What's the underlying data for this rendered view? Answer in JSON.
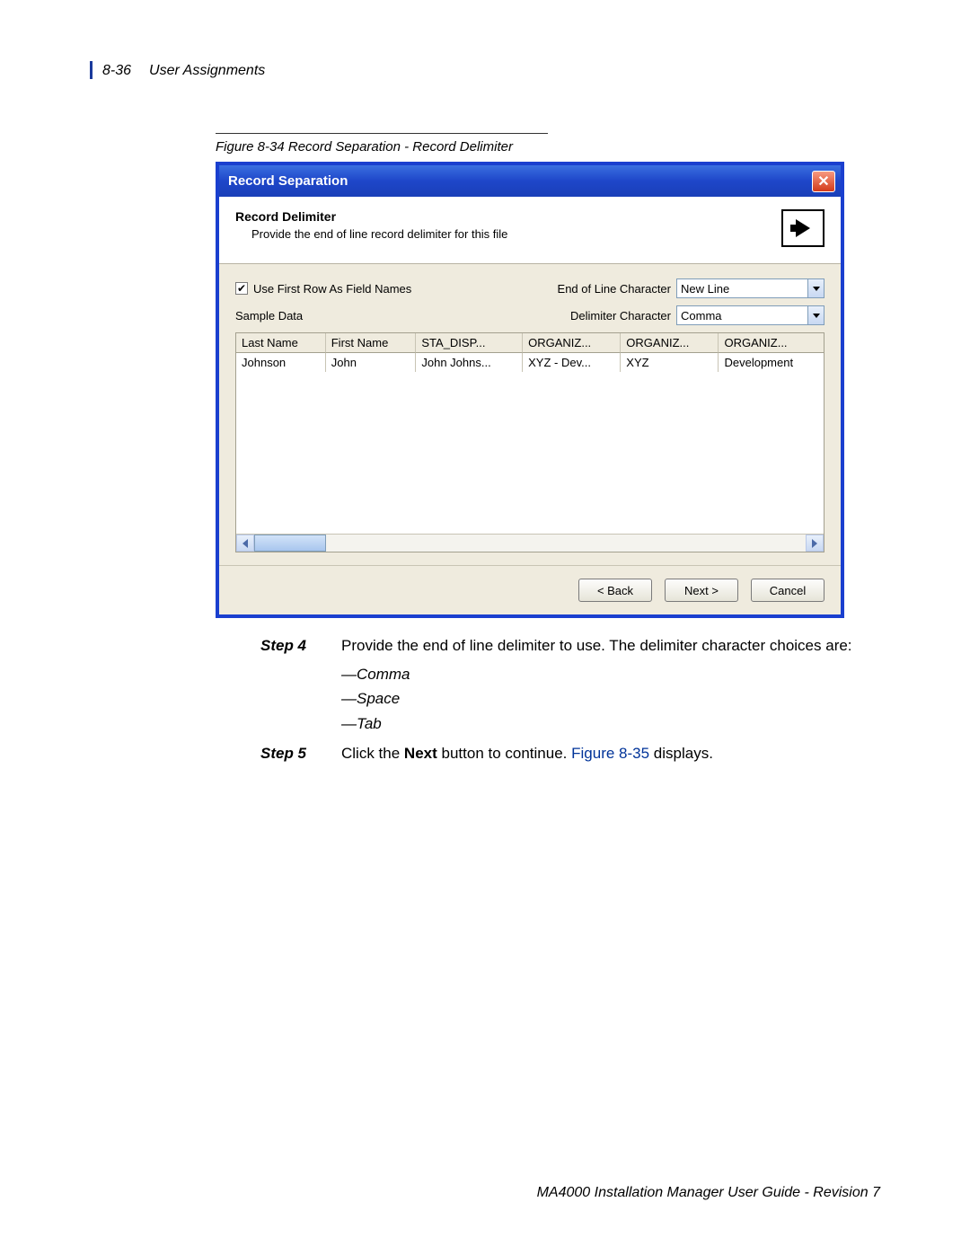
{
  "header": {
    "page_num": "8-36",
    "section": "User Assignments"
  },
  "caption": "Figure 8-34  Record Separation - Record Delimiter",
  "dialog": {
    "title": "Record Separation",
    "heading": "Record Delimiter",
    "subhead": "Provide the end of line record delimiter for this file",
    "checkbox_label": "Use First Row As Field Names",
    "eol_label": "End of Line Character",
    "eol_value": "New Line",
    "delim_label": "Delimiter Character",
    "delim_value": "Comma",
    "sample_label": "Sample Data",
    "columns": [
      "Last Name",
      "First Name",
      "STA_DISP...",
      "ORGANIZ...",
      "ORGANIZ...",
      "ORGANIZ..."
    ],
    "row": [
      "Johnson",
      "John",
      "John Johns...",
      "XYZ - Dev...",
      "XYZ",
      "Development"
    ],
    "btn_back": "< Back",
    "btn_next": "Next >",
    "btn_cancel": "Cancel"
  },
  "steps": {
    "s4_label": "Step 4",
    "s4_text": "Provide the end of line delimiter to use. The delimiter character choices are:",
    "choices": [
      "—Comma",
      "—Space",
      "—Tab"
    ],
    "s5_label": "Step 5",
    "s5_pre": "Click the ",
    "s5_bold": "Next",
    "s5_mid": " button to continue. ",
    "s5_link": "Figure 8-35",
    "s5_post": " displays."
  },
  "footer": "MA4000 Installation Manager User Guide - Revision 7"
}
